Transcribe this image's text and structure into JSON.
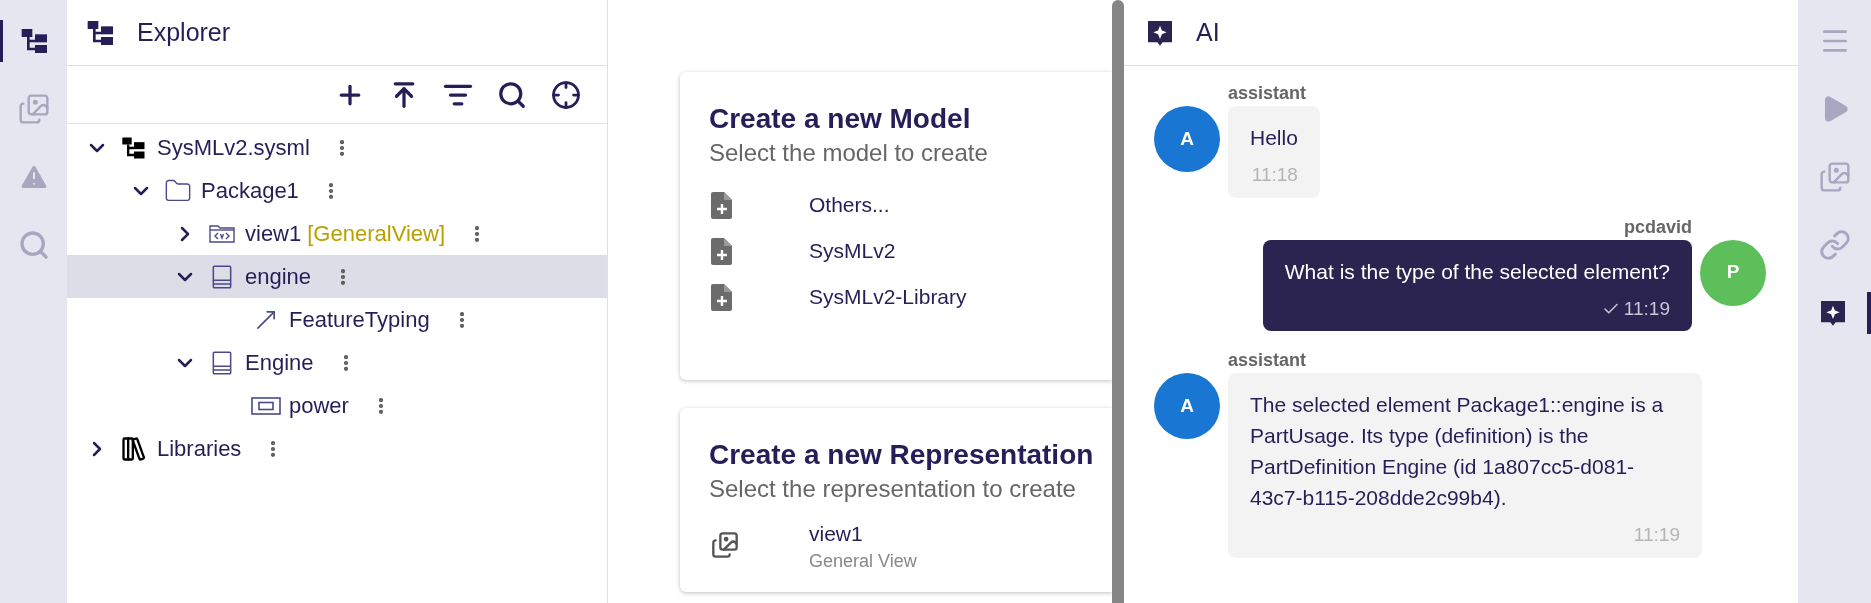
{
  "left_rail": {
    "items": [
      {
        "kind": "explorer",
        "selected": true
      },
      {
        "kind": "representations",
        "selected": false
      },
      {
        "kind": "validation",
        "selected": false
      },
      {
        "kind": "search",
        "selected": false
      }
    ]
  },
  "explorer": {
    "title": "Explorer",
    "toolbar": [
      {
        "kind": "new"
      },
      {
        "kind": "upload"
      },
      {
        "kind": "filter"
      },
      {
        "kind": "search"
      },
      {
        "kind": "reveal"
      }
    ],
    "tree": [
      {
        "label": "SysMLv2.sysml",
        "kind": "model",
        "expanded": true,
        "selected": false,
        "children": [
          {
            "label": "Package1",
            "kind": "package",
            "expanded": true,
            "selected": false,
            "children": [
              {
                "label": "view1",
                "suffix": "[GeneralView]",
                "kind": "view",
                "expanded": false,
                "selected": false
              },
              {
                "label": "engine",
                "kind": "part-usage",
                "expanded": true,
                "selected": true,
                "children": [
                  {
                    "label": "FeatureTyping",
                    "kind": "feature-typing",
                    "selected": false
                  }
                ]
              },
              {
                "label": "Engine",
                "kind": "part-definition",
                "expanded": true,
                "selected": false,
                "children": [
                  {
                    "label": "power",
                    "kind": "attribute",
                    "selected": false
                  }
                ]
              }
            ]
          }
        ]
      },
      {
        "label": "Libraries",
        "kind": "libraries",
        "expanded": false,
        "selected": false
      }
    ]
  },
  "onboard": {
    "cards": [
      {
        "title": "Create a new Model",
        "subtitle": "Select the model to create",
        "items": [
          {
            "kind": "file-add",
            "label": "Others..."
          },
          {
            "kind": "file-add",
            "label": "SysMLv2"
          },
          {
            "kind": "file-add",
            "label": "SysMLv2-Library"
          }
        ]
      },
      {
        "title": "Create a new Representation",
        "subtitle": "Select the representation to create",
        "items": [
          {
            "kind": "representation",
            "label": "view1",
            "sublabel": "General View"
          }
        ]
      }
    ]
  },
  "ai_panel": {
    "title": "AI",
    "messages": [
      {
        "kind": "assistant",
        "author": "assistant",
        "avatar": "A",
        "color": "#1976d2",
        "text": "Hello",
        "time": "11:18",
        "delivered": false
      },
      {
        "kind": "user",
        "author": "pcdavid",
        "avatar": "P",
        "color": "#5cbf5a",
        "text": "What is the type of the selected element?",
        "time": "11:19",
        "delivered": true
      },
      {
        "kind": "assistant",
        "author": "assistant",
        "avatar": "A",
        "color": "#1976d2",
        "text": "The selected element Package1::engine is a PartUsage. Its type (definition) is the PartDefinition Engine (id 1a807cc5-d081-43c7-b115-208dde2c99b4).",
        "time": "11:19",
        "delivered": false
      }
    ]
  },
  "right_rail": {
    "items": [
      {
        "kind": "menu",
        "selected": false
      },
      {
        "kind": "run",
        "selected": false
      },
      {
        "kind": "representations",
        "selected": false
      },
      {
        "kind": "links",
        "selected": false
      },
      {
        "kind": "ai",
        "selected": true
      }
    ]
  }
}
